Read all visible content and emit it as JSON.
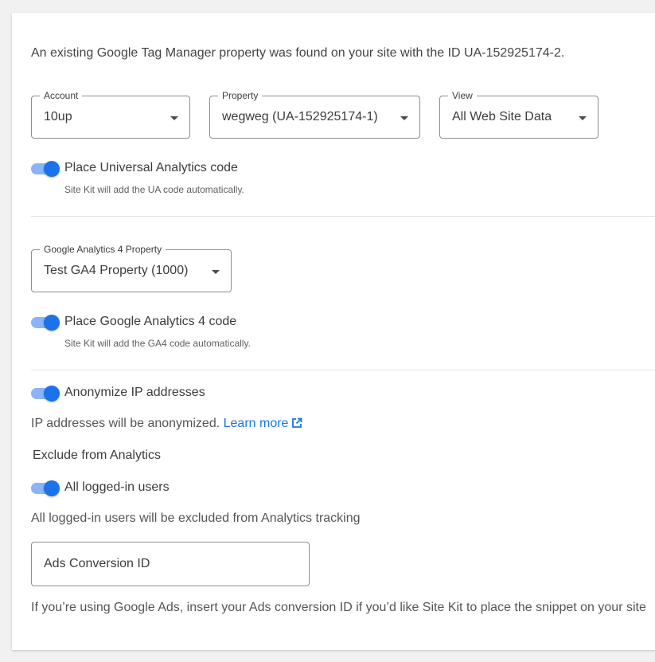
{
  "intro": "An existing Google Tag Manager property was found on your site with the ID UA-152925174-2.",
  "ua_selects": {
    "account": {
      "label": "Account",
      "value": "10up"
    },
    "property": {
      "label": "Property",
      "value": "wegweg (UA-152925174-1)"
    },
    "view": {
      "label": "View",
      "value": "All Web Site Data"
    }
  },
  "ua_toggle": {
    "label": "Place Universal Analytics code",
    "help": "Site Kit will add the UA code automatically.",
    "on": true
  },
  "ga4_select": {
    "label": "Google Analytics 4 Property",
    "value": "Test GA4 Property (1000)"
  },
  "ga4_toggle": {
    "label": "Place Google Analytics 4 code",
    "help": "Site Kit will add the GA4 code automatically.",
    "on": true
  },
  "anonymize": {
    "label": "Anonymize IP addresses",
    "on": true,
    "note": "IP addresses will be anonymized.",
    "link": "Learn more"
  },
  "exclude": {
    "heading": "Exclude from Analytics",
    "toggle_label": "All logged-in users",
    "on": true,
    "note": "All logged-in users will be excluded from Analytics tracking"
  },
  "ads": {
    "placeholder": "Ads Conversion ID",
    "help": "If you’re using Google Ads, insert your Ads conversion ID if you’d like Site Kit to place the snippet on your site"
  },
  "colors": {
    "accent": "#1a73e8",
    "track": "#8ab4f8"
  }
}
